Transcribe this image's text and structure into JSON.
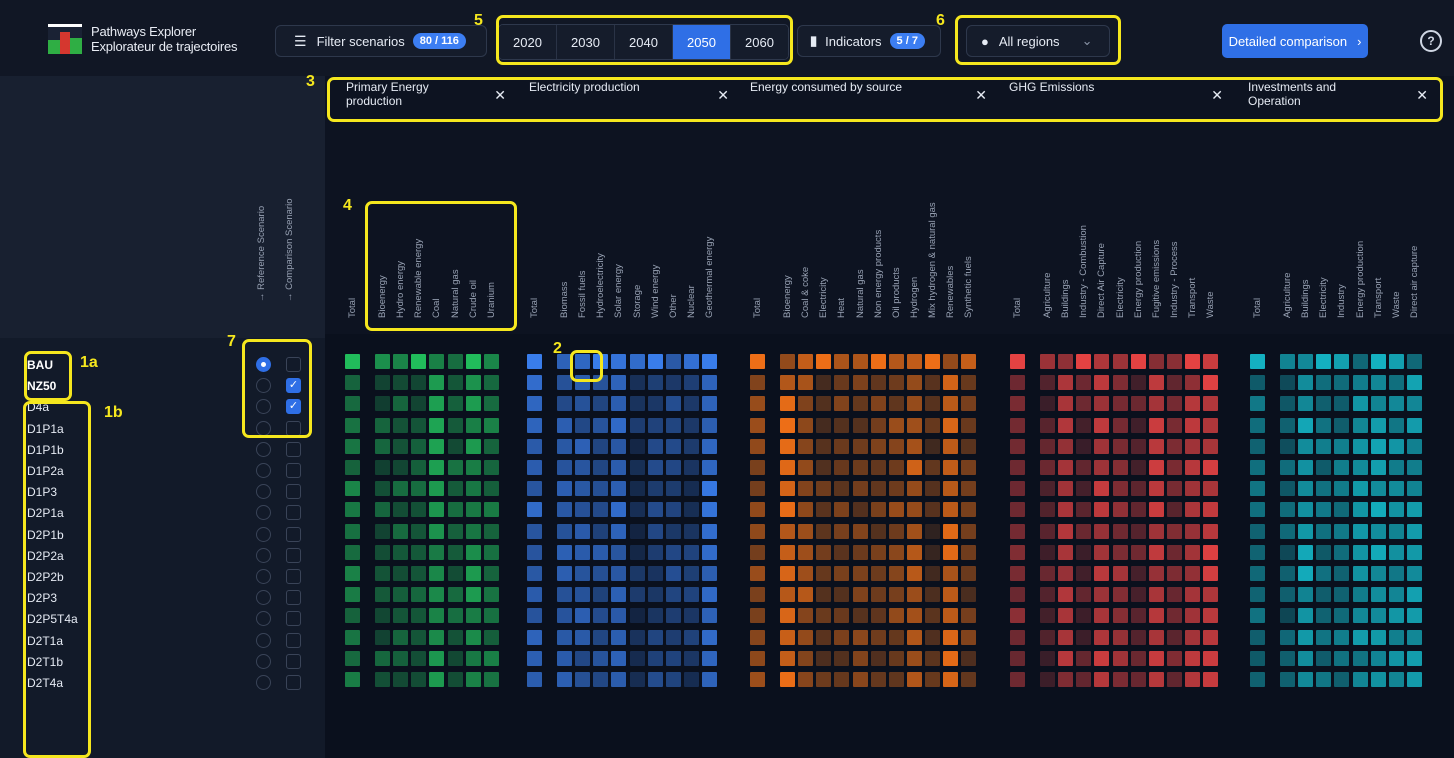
{
  "header": {
    "logo_line1": "Pathways Explorer",
    "logo_line2": "Explorateur de trajectoires",
    "filter_label": "Filter scenarios",
    "filter_badge": "80 / 116",
    "years": [
      "2020",
      "2030",
      "2040",
      "2050",
      "2060"
    ],
    "active_year": "2050",
    "indicators_label": "Indicators",
    "indicators_badge": "5 / 7",
    "region": "All regions",
    "detailed_label": "Detailed comparison",
    "help": "?"
  },
  "tabs": [
    "Primary Energy production",
    "Electricity production",
    "Energy consumed by source",
    "GHG Emissions",
    "Investments and Operation"
  ],
  "scenario_headers": [
    "→ Reference Scenario",
    "→ Comparison Scenario"
  ],
  "groups": [
    {
      "name": "Primary Energy production",
      "color": "#22c55e",
      "columns": [
        "Total",
        "Bioenergy",
        "Hydro energy",
        "Renewable energy",
        "Coal",
        "Natural gas",
        "Crude oil",
        "Uranium"
      ]
    },
    {
      "name": "Electricity production",
      "color": "#3b82f6",
      "columns": [
        "Total",
        "Biomass",
        "Fossil fuels",
        "Hydroelectricity",
        "Solar energy",
        "Storage",
        "Wind energy",
        "Other",
        "Nuclear",
        "Geothermal energy"
      ]
    },
    {
      "name": "Energy consumed by source",
      "color": "#f97316",
      "columns": [
        "Total",
        "Bioenergy",
        "Coal & coke",
        "Electricity",
        "Heat",
        "Natural gas",
        "Non energy products",
        "Oil products",
        "Hydrogen",
        "Mix hydrogen & natural gas",
        "Renewables",
        "Synthetic fuels"
      ]
    },
    {
      "name": "GHG Emissions",
      "color": "#ef4444",
      "columns": [
        "Total",
        "Agriculture",
        "Buildings",
        "Industry - Combustion",
        "Direct Air Capture",
        "Electricity",
        "Energy production",
        "Fugitive emissions",
        "Industry - Process",
        "Transport",
        "Waste"
      ]
    },
    {
      "name": "Investments and Operation",
      "color": "#14b8c8",
      "columns": [
        "Total",
        "Agriculture",
        "Buildings",
        "Electricity",
        "Industry",
        "Energy production",
        "Transport",
        "Waste",
        "Direct air capture"
      ]
    }
  ],
  "scenarios": [
    "BAU",
    "NZ50",
    "D4a",
    "D1P1a",
    "D1P1b",
    "D1P2a",
    "D1P3",
    "D2P1a",
    "D2P1b",
    "D2P2a",
    "D2P2b",
    "D2P3",
    "D2P5T4a",
    "D2T1a",
    "D2T1b",
    "D2T4a"
  ],
  "reference_scenario": "BAU",
  "comparison_scenarios": [
    "NZ50",
    "D4a"
  ],
  "annotations": [
    "5",
    "6",
    "3",
    "4",
    "7",
    "2",
    "1a",
    "1b"
  ]
}
